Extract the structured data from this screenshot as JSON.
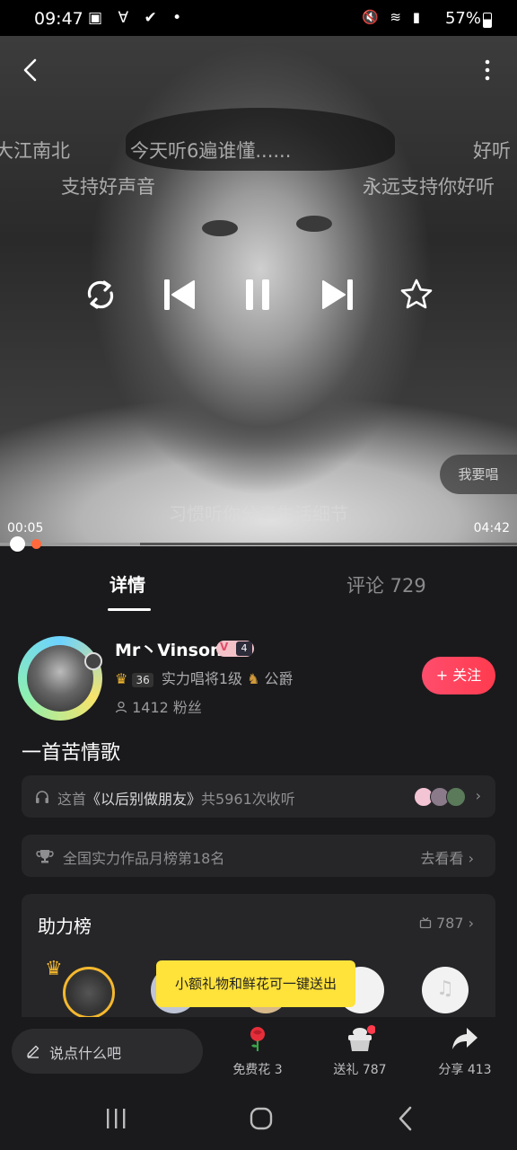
{
  "status_bar": {
    "time": "09:47",
    "battery": "57%"
  },
  "player": {
    "danmaku": [
      "大江南北",
      "今天听6遍谁懂......",
      "好听",
      "支持好声音",
      "永远支持你好听"
    ],
    "sing_button": "我要唱",
    "subtitle": "习惯听你分享生活细节",
    "current_time": "00:05",
    "duration": "04:42",
    "progress_fraction": 0.018
  },
  "tabs": {
    "details": "详情",
    "comments": "评论 729"
  },
  "profile": {
    "name": "Mr丶Vinson",
    "vip_level": "4",
    "level_num": "36",
    "rank_text": "实力唱将1级",
    "title": "公爵",
    "fans": "1412 粉丝",
    "follow_button": "+ 关注"
  },
  "song": {
    "title": "一首苦情歌",
    "listen_prefix": "这首",
    "listen_song": "《以后别做朋友》",
    "listen_suffix": "共5961次收听",
    "rank_text": "全国实力作品月榜第18名",
    "rank_go": "去看看"
  },
  "support": {
    "title": "助力榜",
    "count": "787",
    "tooltip": "小额礼物和鲜花可一键送出"
  },
  "bottom_bar": {
    "input_placeholder": "说点什么吧",
    "flower_label": "免费花 3",
    "gift_label": "送礼 787",
    "share_label": "分享 413"
  },
  "colors": {
    "accent_red": "#ff3b4e",
    "tooltip_yellow": "#ffe23a",
    "progress_dot": "#ff6a3d"
  },
  "icons": [
    "back-icon",
    "more-icon",
    "loop-icon",
    "prev-icon",
    "pause-icon",
    "next-icon",
    "star-icon",
    "headphones-icon",
    "trophy-icon",
    "gift-box-icon",
    "rose-icon",
    "gift-icon",
    "share-icon",
    "pencil-icon",
    "user-icon",
    "crown-icon"
  ]
}
